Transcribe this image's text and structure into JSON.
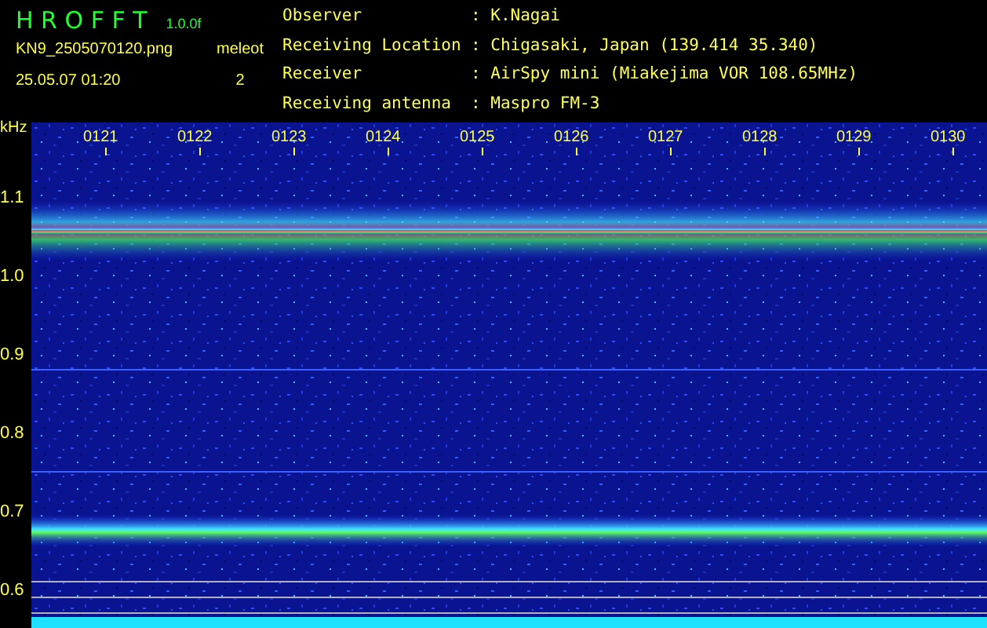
{
  "header": {
    "title": "H R O F F T",
    "version": "1.0.0f",
    "filename": "KN9_2505070120.png",
    "timestamp": "25.05.07 01:20",
    "counter_label": "meleot",
    "counter_value": "2"
  },
  "info": [
    {
      "label": "Observer",
      "value": ": K.Nagai"
    },
    {
      "label": "Receiving Location",
      "value": ": Chigasaki, Japan (139.414 35.340)"
    },
    {
      "label": "Receiver",
      "value": ": AirSpy mini (Miakejima VOR 108.65MHz)"
    },
    {
      "label": "Receiving antenna",
      "value": ": Maspro FM-3"
    }
  ],
  "axis": {
    "unit": "kHz",
    "labels": [
      "1.1",
      "1.0",
      "0.9",
      "0.8",
      "0.7",
      "0.6"
    ]
  },
  "time_labels": [
    "0121",
    "0122",
    "0123",
    "0124",
    "0125",
    "0126",
    "0127",
    "0128",
    "0129",
    "0130"
  ]
}
